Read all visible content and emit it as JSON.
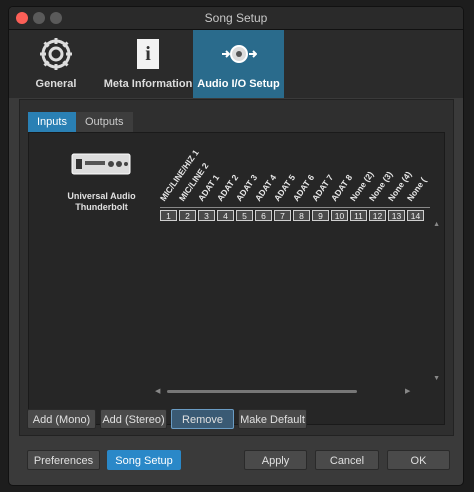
{
  "window": {
    "title": "Song Setup"
  },
  "top_tabs": [
    {
      "label": "General",
      "icon": "gear-icon"
    },
    {
      "label": "Meta Information",
      "icon": "info-icon"
    },
    {
      "label": "Audio I/O Setup",
      "icon": "audio-io-icon"
    }
  ],
  "sub_tabs": [
    {
      "label": "Inputs"
    },
    {
      "label": "Outputs"
    }
  ],
  "device": {
    "name_line1": "Universal Audio",
    "name_line2": "Thunderbolt"
  },
  "channels": [
    {
      "name": "MIC/LINE/HIZ 1",
      "num": "1"
    },
    {
      "name": "MIC/LINE 2",
      "num": "2"
    },
    {
      "name": "ADAT 1",
      "num": "3"
    },
    {
      "name": "ADAT 2",
      "num": "4"
    },
    {
      "name": "ADAT 3",
      "num": "5"
    },
    {
      "name": "ADAT 4",
      "num": "6"
    },
    {
      "name": "ADAT 5",
      "num": "7"
    },
    {
      "name": "ADAT 6",
      "num": "8"
    },
    {
      "name": "ADAT 7",
      "num": "9"
    },
    {
      "name": "ADAT 8",
      "num": "10"
    },
    {
      "name": "None (2)",
      "num": "11"
    },
    {
      "name": "None (3)",
      "num": "12"
    },
    {
      "name": "None (4)",
      "num": "13"
    },
    {
      "name": "None (",
      "num": "14"
    }
  ],
  "actions": {
    "add_mono": "Add (Mono)",
    "add_stereo": "Add (Stereo)",
    "remove": "Remove",
    "make_default": "Make Default"
  },
  "footer": {
    "preferences": "Preferences",
    "song_setup": "Song Setup",
    "apply": "Apply",
    "cancel": "Cancel",
    "ok": "OK"
  }
}
